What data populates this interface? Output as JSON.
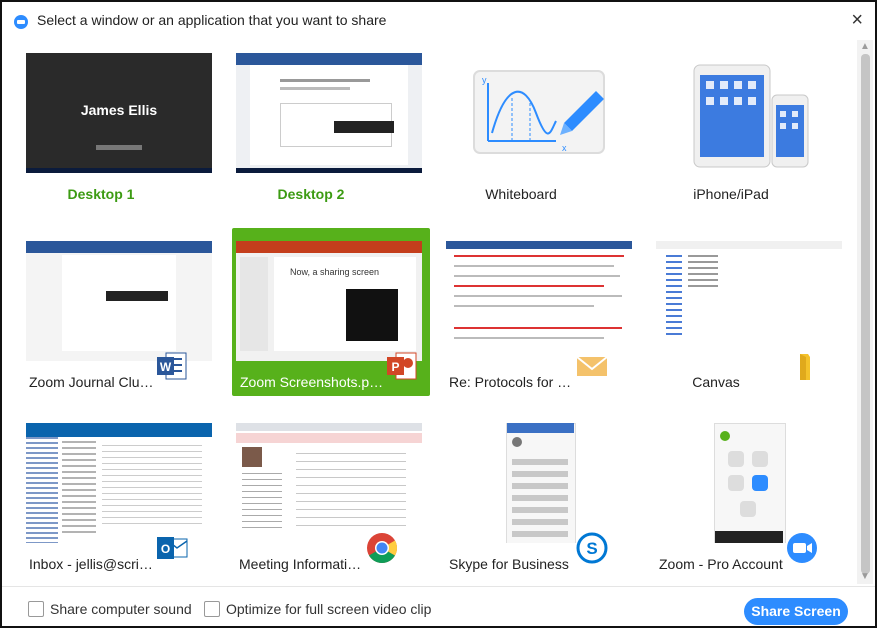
{
  "window": {
    "title": "Select a window or an application that you want to share",
    "close_label": "×"
  },
  "tiles": [
    {
      "caption": "Desktop 1",
      "kind": "desktop",
      "overlay": "James Ellis"
    },
    {
      "caption": "Desktop 2",
      "kind": "desktop"
    },
    {
      "caption": "Whiteboard",
      "kind": "whiteboard"
    },
    {
      "caption": "iPhone/iPad",
      "kind": "device"
    },
    {
      "caption": "Zoom Journal Club Pres...",
      "kind": "app",
      "icon": "word-icon"
    },
    {
      "caption": "Zoom Screenshots.pptx ...",
      "kind": "app",
      "icon": "powerpoint-icon",
      "selected": true,
      "overlay": "Now, a sharing screen"
    },
    {
      "caption": "Re: Protocols for Present...",
      "kind": "app",
      "icon": "mail-icon"
    },
    {
      "caption": "Canvas",
      "kind": "app",
      "icon": "folder-icon"
    },
    {
      "caption": "Inbox - jellis@scripps.ed...",
      "kind": "app",
      "icon": "outlook-icon"
    },
    {
      "caption": "Meeting Information - Z...",
      "kind": "app",
      "icon": "chrome-icon"
    },
    {
      "caption": "Skype for Business",
      "kind": "app",
      "icon": "skype-icon"
    },
    {
      "caption": "Zoom - Pro Account",
      "kind": "app",
      "icon": "zoom-icon"
    }
  ],
  "footer": {
    "share_sound": "Share computer sound",
    "optimize_video": "Optimize for full screen video clip",
    "share_button": "Share Screen"
  },
  "colors": {
    "accent": "#2d8cff",
    "selected": "#57b11b",
    "caption_green": "#3c9b13"
  }
}
